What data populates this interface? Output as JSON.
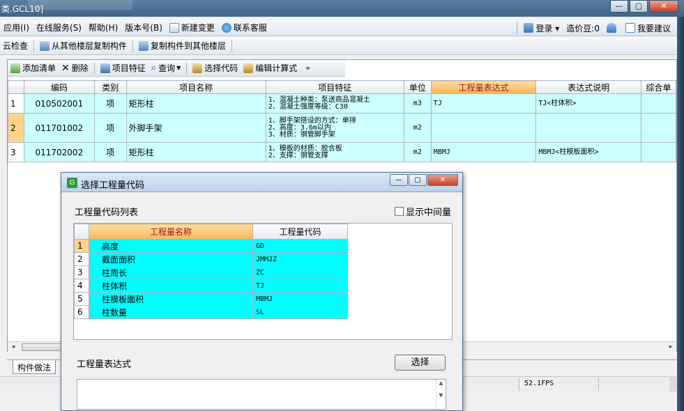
{
  "window": {
    "title": "类.GCL10]",
    "btn_min": "—",
    "btn_max": "▢",
    "btn_close": "✕"
  },
  "menubar": {
    "items": [
      "应用(I)",
      "在线服务(S)",
      "帮助(H)",
      "版本号(B)",
      "新建变更",
      "联系客服"
    ],
    "login": "登录 ▾",
    "cost_beans": "造价豆:0",
    "suggest": "我要建议"
  },
  "toolbar2": {
    "items": [
      "云检查",
      "从其他楼层复制构件",
      "复制构件到其他楼层"
    ]
  },
  "toolbar3": {
    "add_list": "添加清单",
    "delete": "删除",
    "item_features": "项目特征",
    "query": "查询",
    "select_code": "选择代码",
    "edit_formula": "编辑计算式",
    "more": "»"
  },
  "grid": {
    "headers": [
      "",
      "编码",
      "类别",
      "项目名称",
      "项目特征",
      "单位",
      "工程量表达式",
      "表达式说明",
      "综合单"
    ],
    "rows": [
      {
        "no": "1",
        "code": "010502001",
        "type": "项",
        "name": "矩形柱",
        "feat1": "1、混凝土种类：泵送商品混凝土",
        "feat2": "2、混凝土强度等级：C30",
        "feat3": "",
        "unit": "m3",
        "expr": "TJ",
        "desc": "TJ<柱体积>"
      },
      {
        "no": "2",
        "code": "011701002",
        "type": "项",
        "name": "外脚手架",
        "feat1": "1、脚手架搭设的方式：单排",
        "feat2": "2、高度：3.6m以内",
        "feat3": "3、材质：钢管脚手架",
        "unit": "m2",
        "expr": "",
        "desc": ""
      },
      {
        "no": "3",
        "code": "011702002",
        "type": "项",
        "name": "矩形柱",
        "feat1": "1、模板的材质：胶合板",
        "feat2": "2、支撑：钢管支撑",
        "feat3": "",
        "unit": "m2",
        "expr": "MBMJ",
        "desc": "MBMJ<柱模板面积>"
      }
    ]
  },
  "bottom_tab": "构件做法",
  "status": {
    "fps": "52.1FPS"
  },
  "dialog": {
    "title": "选择工程量代码",
    "list_label": "工程量代码列表",
    "show_intermediate": "显示中间量",
    "headers": [
      "",
      "工程量名称",
      "工程量代码"
    ],
    "rows": [
      {
        "no": "1",
        "name": "高度",
        "code": "GD"
      },
      {
        "no": "2",
        "name": "截面面积",
        "code": "JMMJZ"
      },
      {
        "no": "3",
        "name": "柱周长",
        "code": "ZC"
      },
      {
        "no": "4",
        "name": "柱体积",
        "code": "TJ"
      },
      {
        "no": "5",
        "name": "柱模板面积",
        "code": "MBMJ"
      },
      {
        "no": "6",
        "name": "柱数量",
        "code": "SL"
      }
    ],
    "expr_label": "工程量表达式",
    "select_button": "选择"
  }
}
